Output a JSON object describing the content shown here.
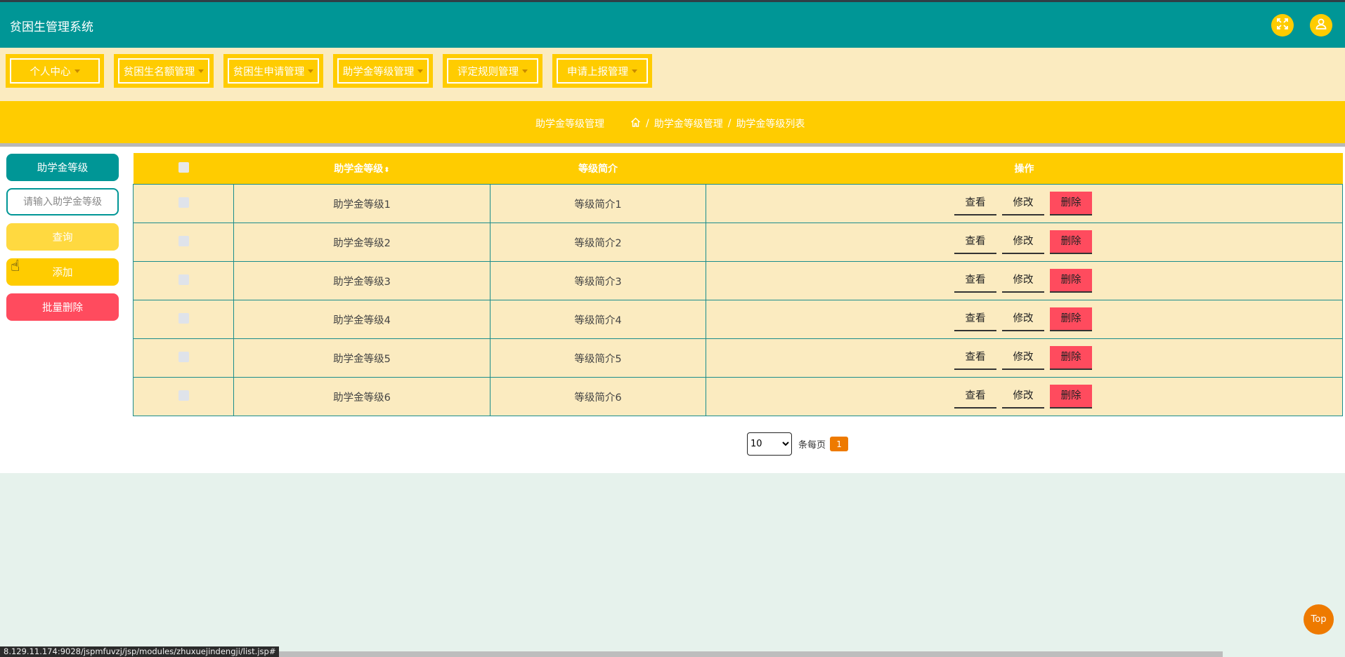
{
  "app": {
    "title": "贫困生管理系统"
  },
  "header": {
    "icons": [
      "fullscreen-icon",
      "user-icon"
    ]
  },
  "nav": {
    "items": [
      {
        "label": "个人中心"
      },
      {
        "label": "贫困生名额管理"
      },
      {
        "label": "贫困生申请管理"
      },
      {
        "label": "助学金等级管理"
      },
      {
        "label": "评定规则管理"
      },
      {
        "label": "申请上报管理"
      }
    ]
  },
  "breadcrumb": {
    "title": "助学金等级管理",
    "path": [
      "助学金等级管理",
      "助学金等级列表"
    ]
  },
  "sidebar": {
    "heading": "助学金等级",
    "search_placeholder": "请输入助学金等级",
    "query_label": "查询",
    "add_label": "添加",
    "batch_delete_label": "批量删除"
  },
  "table": {
    "columns": [
      "助学金等级",
      "等级简介",
      "操作"
    ],
    "rows": [
      {
        "level": "助学金等级1",
        "intro": "等级简介1"
      },
      {
        "level": "助学金等级2",
        "intro": "等级简介2"
      },
      {
        "level": "助学金等级3",
        "intro": "等级简介3"
      },
      {
        "level": "助学金等级4",
        "intro": "等级简介4"
      },
      {
        "level": "助学金等级5",
        "intro": "等级简介5"
      },
      {
        "level": "助学金等级6",
        "intro": "等级简介6"
      }
    ],
    "actions": {
      "view": "查看",
      "edit": "修改",
      "delete": "删除"
    }
  },
  "pagination": {
    "page_size": "10",
    "page_size_options": [
      "10"
    ],
    "per_page_label": "条每页",
    "current_page": "1"
  },
  "back_to_top": "Top",
  "status_url": "8.129.11.174:9028/jspmfuvzj/jsp/modules/zhuxuejindengji/list.jsp#"
}
